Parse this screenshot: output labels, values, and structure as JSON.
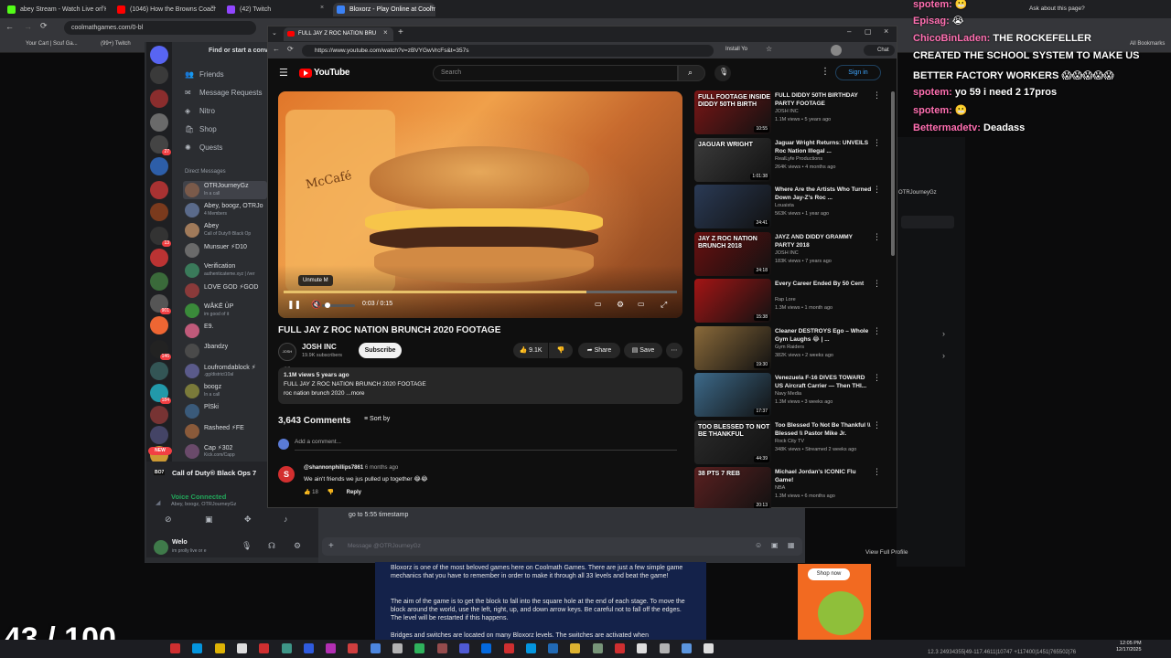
{
  "outer_browser": {
    "tabs": [
      {
        "label": "abey Stream - Watch Live on K",
        "color": "#53fc18"
      },
      {
        "label": "(1046) How the Browns Coach",
        "color": "#ff0000"
      },
      {
        "label": "(42) Twitch",
        "color": "#9146ff"
      },
      {
        "label": "Bloxorz - Play Online at Coolm",
        "color": "#3b82f6"
      }
    ],
    "url": "coolmathgames.com/0-bl",
    "bookmarks": [
      "Your Cart | Scuf Ga...",
      "(99+) Twitch"
    ],
    "ask_label": "Ask about this page?",
    "all_bookmarks": "All Bookmarks"
  },
  "discord": {
    "search_placeholder": "Find or start a conve",
    "nav": [
      {
        "label": "Friends",
        "icon": "friends-icon"
      },
      {
        "label": "Message Requests",
        "icon": "mail-icon"
      },
      {
        "label": "Nitro",
        "icon": "nitro-icon"
      },
      {
        "label": "Shop",
        "icon": "shop-icon"
      },
      {
        "label": "Quests",
        "icon": "quests-icon"
      }
    ],
    "dm_header": "Direct Messages",
    "dms": [
      {
        "name": "OTRJourneyGz",
        "status": "In a call"
      },
      {
        "name": "Abey, boogz, OTRJo",
        "status": "4 Members"
      },
      {
        "name": "Abey",
        "status": "Call of Duty® Black Op"
      },
      {
        "name": "Munsuer ⚡D10",
        "status": ""
      },
      {
        "name": "Verification",
        "status": "authenticateme.xyz | /ver"
      },
      {
        "name": "LOVE GOD ⚡GOD",
        "status": ""
      },
      {
        "name": "WÅKĒ ÜP",
        "status": "im good of it"
      },
      {
        "name": "E9.",
        "status": ""
      },
      {
        "name": "Jbandzy",
        "status": ""
      },
      {
        "name": "Loufromdablock ⚡",
        "status": ".gg/district10al"
      },
      {
        "name": "boogz",
        "status": "In a call"
      },
      {
        "name": "PlSki",
        "status": ""
      },
      {
        "name": "Rasheed ⚡FE",
        "status": ""
      },
      {
        "name": "Cap ⚡302",
        "status": "Kick.com/Capp"
      }
    ],
    "server_badges": [
      "27",
      "13",
      "901",
      "146",
      "184",
      "NEW"
    ],
    "game_title": "Call of Duty® Black Ops 7",
    "voice_status": "Voice Connected",
    "voice_members": "Abey, boogz, OTRJourneyGz",
    "user_name": "Welo",
    "user_status": "im prolly live or e",
    "chat_message": "go to 5:55 timestamp",
    "input_placeholder": "Message @OTRJourneyGz",
    "view_profile": "View Full Profile",
    "profile_name": "OTRJourneyGz"
  },
  "stream_chat": [
    {
      "user": "spotem:",
      "msg": "😬"
    },
    {
      "user": "Episag:",
      "msg": "😭"
    },
    {
      "user": "ChicoBinLaden:",
      "msg": "THE ROCKEFELLER"
    },
    {
      "user": "",
      "msg": "CREATED THE SCHOOL SYSTEM TO MAKE US"
    },
    {
      "user": "",
      "msg": "BETTER FACTORY WORKERS 😱😱😱😱😱"
    },
    {
      "user": "spotem:",
      "msg": "yo 59 i need 2 17pros"
    },
    {
      "user": "spotem:",
      "msg": "😬"
    },
    {
      "user": "Bettermadetv:",
      "msg": "Deadass"
    }
  ],
  "youtube": {
    "tab_title": "FULL JAY Z ROC NATION BRU",
    "url": "https://www.youtube.com/watch?v=zBVYGwVrcFs&t=357s",
    "install_label": "Install Yo",
    "chat_label": "Chat",
    "logo_text": "YouTube",
    "search_placeholder": "Search",
    "sign_in": "Sign in",
    "video": {
      "unmute_tip": "Unmute  M",
      "time": "0:03 / 0:15",
      "progress": 0.77,
      "cup_text": "McCafé"
    },
    "title": "FULL JAY Z ROC NATION BRUNCH 2020 FOOTAGE",
    "channel": {
      "name": "JOSH INC",
      "subs": "19.9K subscribers",
      "avatar_text": "JOSH INC"
    },
    "subscribe": "Subscribe",
    "likes": "9.1K",
    "share": "Share",
    "save": "Save",
    "description": {
      "meta": "1.1M views  5 years ago",
      "line1": "FULL JAY Z ROC NATION BRUNCH 2020 FOOTAGE",
      "line2": "roc nation brunch 2020 ...more"
    },
    "comments_count": "3,643 Comments",
    "sort_by": "Sort by",
    "add_comment": "Add a comment...",
    "comment": {
      "avatar": "S",
      "user": "@shannonphillips7861",
      "time": "6 months ago",
      "text": "We ain't friends we jus pulled up together 😂😂",
      "likes": "18",
      "reply": "Reply"
    },
    "recommendations": [
      {
        "title": "FULL DIDDY 50TH BIRTHDAY PARTY FOOTAGE",
        "channel": "JOSH INC",
        "views": "1.1M views • 5 years ago",
        "duration": "10:55",
        "thumb": "FULL FOOTAGE INSIDE DIDDY 50TH BIRTH",
        "color": "#7a1616"
      },
      {
        "title": "Jaguar Wright Returns: UNVEILS Roc Nation Illegal ...",
        "channel": "RealLyfe Productions",
        "views": "264K views • 4 months ago",
        "duration": "1:01:38",
        "thumb": "JAGUAR WRIGHT",
        "color": "#3c3c3c"
      },
      {
        "title": "Where Are the Artists Who Turned Down Jay-Z's Roc ...",
        "channel": "Louaista",
        "views": "563K views • 1 year ago",
        "duration": "24:41",
        "thumb": "",
        "color": "#2a3a55"
      },
      {
        "title": "JAYZ AND DIDDY GRAMMY PARTY 2018",
        "channel": "JOSH INC",
        "views": "183K views • 7 years ago",
        "duration": "24:18",
        "thumb": "JAY Z ROC NATION BRUNCH 2018",
        "color": "#6a1010"
      },
      {
        "title": "Every Career Ended By 50 Cent",
        "channel": "Rap Lore",
        "views": "1.3M views • 1 month ago",
        "duration": "15:38",
        "thumb": "",
        "color": "#a31515"
      },
      {
        "title": "Cleaner DESTROYS Ego – Whole Gym Laughs 😂 | ...",
        "channel": "Gym Raiders",
        "views": "382K views • 2 weeks ago",
        "duration": "19:30",
        "thumb": "",
        "color": "#8a6a3a"
      },
      {
        "title": "Venezuela F-16 DIVES TOWARD US Aircraft Carrier — Then THI...",
        "channel": "Navy Media",
        "views": "1.3M views • 3 weeks ago",
        "duration": "17:37",
        "thumb": "",
        "color": "#3d6a8a"
      },
      {
        "title": "Too Blessed To Not Be Thankful \\\\ Blessed \\\\ Pastor Mike Jr.",
        "channel": "Rock City TV",
        "views": "348K views • Streamed 2 weeks ago",
        "duration": "44:39",
        "thumb": "TOO BLESSED TO NOT BE THANKFUL",
        "color": "#2b2b2b"
      },
      {
        "title": "Michael Jordan's ICONIC Flu Game!",
        "channel": "NBA",
        "views": "1.3M views • 6 months ago",
        "duration": "20:13",
        "thumb": "38 PTS 7 REB",
        "color": "#5a2020"
      }
    ]
  },
  "coolmath": {
    "p1": "Bloxorz is one of the most beloved games here on Coolmath Games. There are just a few simple game mechanics that you have to remember in order to make it through all 33 levels and beat the game!",
    "p2": "The aim of the game is to get the block to fall into the square hole at the end of each stage. To move the block around the world, use the left, right, up, and down arrow keys. Be careful not to fall off the edges. The level will be restarted if this happens.",
    "p3": "Bridges and switches are located on many Bloxorz levels. The switches are activated when",
    "ad_button": "Shop now"
  },
  "overlay_counter": "43 / 100",
  "taskbar": {
    "time": "12:05 PM",
    "date": "12/17/2025",
    "coords": "12.3 24934355|49-117.4611|10747 +117400|1451|765502|76"
  }
}
